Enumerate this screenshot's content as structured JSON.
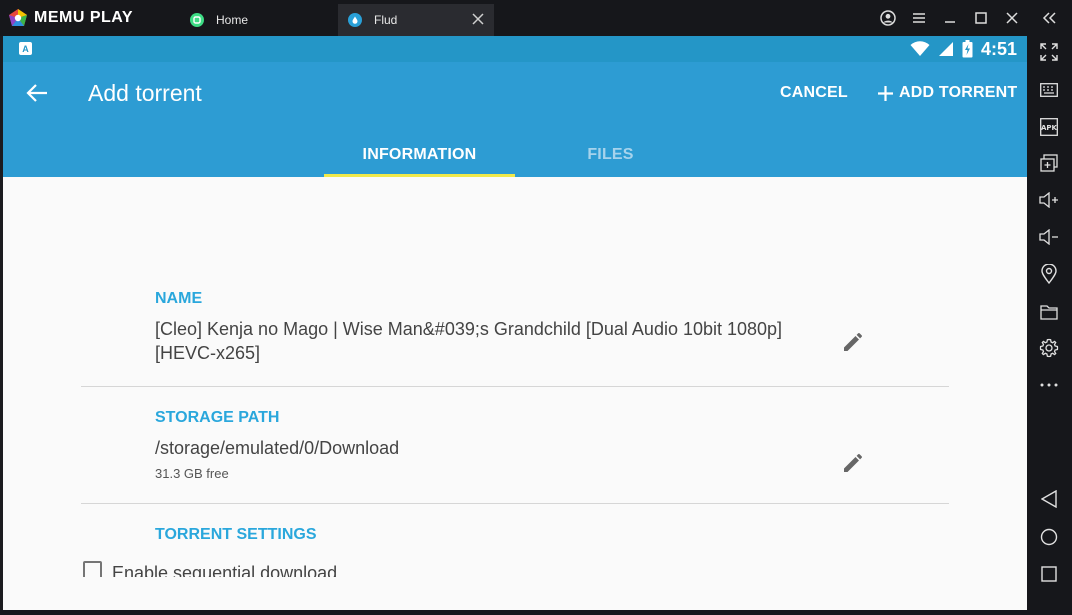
{
  "emulator": {
    "brand": "MEMU PLAY",
    "tabs": [
      {
        "label": "Home",
        "active": false
      },
      {
        "label": "Flud",
        "active": true
      }
    ]
  },
  "status_bar": {
    "left_badge": "A",
    "time": "4:51"
  },
  "app_bar": {
    "title": "Add torrent",
    "cancel_label": "CANCEL",
    "add_label": "ADD TORRENT",
    "color": "#2d9cd3"
  },
  "tabs": [
    {
      "label": "INFORMATION",
      "active": true
    },
    {
      "label": "FILES",
      "active": false
    }
  ],
  "sections": {
    "name": {
      "label": "NAME",
      "value": " [Cleo] Kenja no Mago | Wise Man&#039;s Grandchild [Dual Audio 10bit 1080p][HEVC-x265]"
    },
    "storage": {
      "label": "STORAGE PATH",
      "value": "/storage/emulated/0/Download",
      "free": "31.3 GB free"
    },
    "torrent_settings": {
      "label": "TORRENT SETTINGS",
      "checkbox_label": "Enable sequential download",
      "checked": false
    }
  },
  "sidebar_icons": [
    "fullscreen-icon",
    "keyboard-icon",
    "apk-icon",
    "multi-window-icon",
    "volume-up-icon",
    "volume-down-icon",
    "location-icon",
    "folder-icon",
    "settings-icon",
    "more-icon",
    "back-nav-icon",
    "home-nav-icon",
    "recents-nav-icon"
  ],
  "sidebar_apk_text": "APK"
}
